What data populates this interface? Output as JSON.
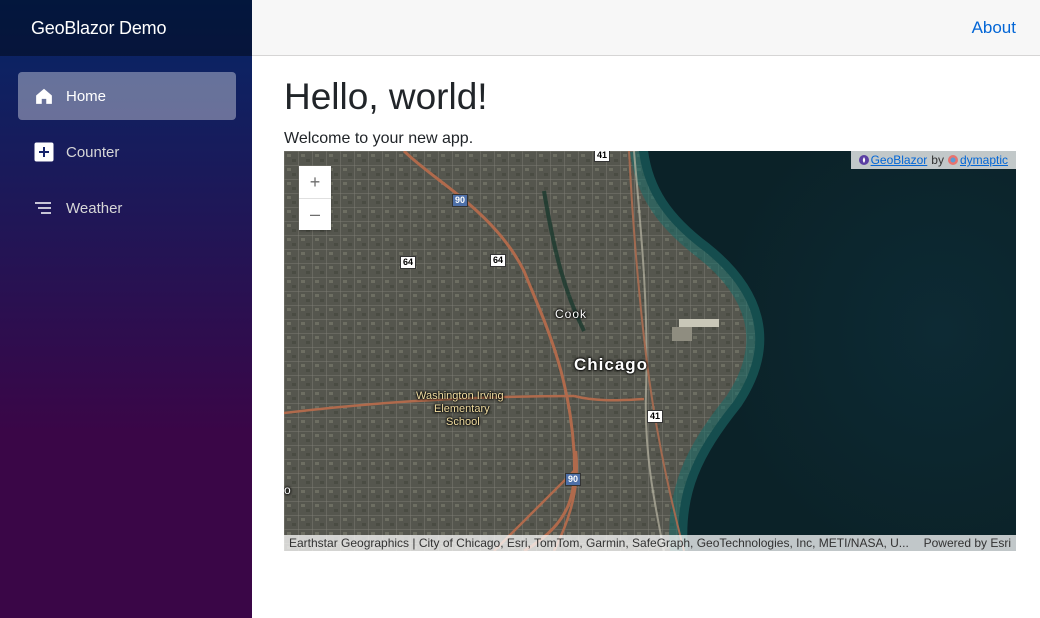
{
  "app": {
    "brand": "GeoBlazor Demo"
  },
  "sidebar": {
    "items": [
      {
        "label": "Home",
        "icon": "home-icon",
        "active": true
      },
      {
        "label": "Counter",
        "icon": "plus-square-icon",
        "active": false
      },
      {
        "label": "Weather",
        "icon": "list-lines-icon",
        "active": false
      }
    ]
  },
  "top_row": {
    "about": "About"
  },
  "main": {
    "title": "Hello, world!",
    "welcome": "Welcome to your new app."
  },
  "map": {
    "zoom_in": "+",
    "zoom_out": "–",
    "credit": {
      "geoblazor": "GeoBlazor",
      "by": "by",
      "dymaptic": "dymaptic"
    },
    "labels": {
      "city": "Chicago",
      "county": "Cook",
      "school_line1": "Washington Irving",
      "school_line2": "Elementary",
      "school_line3": "School",
      "edge_fragment": "o"
    },
    "shields": [
      "41",
      "90",
      "64",
      "64",
      "41",
      "90"
    ],
    "attribution": "Earthstar Geographics | City of Chicago, Esri, TomTom, Garmin, SafeGraph, GeoTechnologies, Inc, METI/NASA, U...",
    "powered_by": "Powered by Esri"
  },
  "colors": {
    "sidebar_top": "#052767",
    "sidebar_bottom": "#3a0647",
    "link": "#0366d6",
    "lake": "#0f3a3e"
  }
}
